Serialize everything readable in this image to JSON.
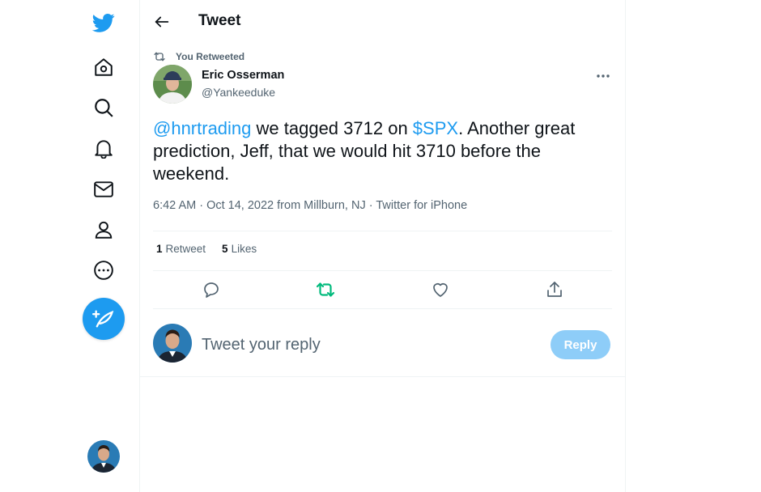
{
  "colors": {
    "accent": "#1d9bf0",
    "retweet_green": "#00ba7c",
    "muted": "#536471",
    "text": "#0f1419"
  },
  "sidebar": {
    "logo_icon": "twitter-bird-icon",
    "items": [
      {
        "name": "home",
        "icon": "home-icon"
      },
      {
        "name": "explore",
        "icon": "search-icon"
      },
      {
        "name": "notifications",
        "icon": "bell-icon"
      },
      {
        "name": "messages",
        "icon": "mail-icon"
      },
      {
        "name": "profile",
        "icon": "person-icon"
      },
      {
        "name": "more",
        "icon": "more-circle-icon"
      }
    ],
    "compose_icon": "feather-plus-icon"
  },
  "header": {
    "title": "Tweet"
  },
  "tweet": {
    "retweet_label": "You Retweeted",
    "author_name": "Eric Osserman",
    "author_handle": "@Yankeeduke",
    "text": {
      "mention": "@hnrtrading",
      "part1": " we tagged 3712 on ",
      "cashtag": "$SPX",
      "part2": ". Another great prediction, Jeff, that we would hit 3710 before the weekend."
    },
    "meta": "6:42 AM · Oct 14, 2022 from Millburn, NJ · Twitter for iPhone",
    "stats": {
      "retweets_count": "1",
      "retweets_label": "Retweet",
      "likes_count": "5",
      "likes_label": "Likes"
    }
  },
  "reply": {
    "placeholder": "Tweet your reply",
    "button_label": "Reply"
  }
}
